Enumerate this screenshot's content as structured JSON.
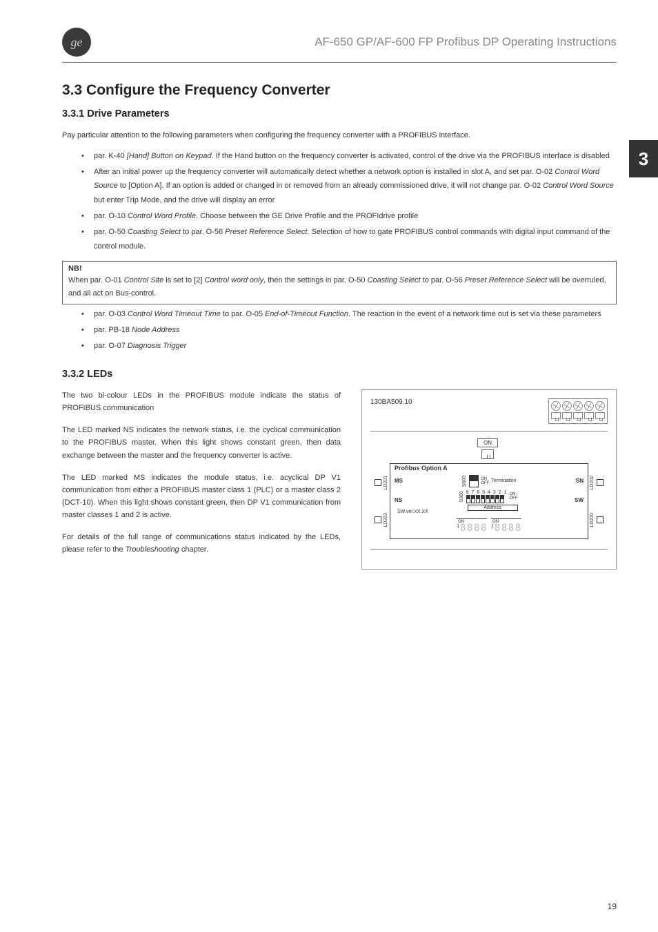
{
  "header": {
    "logo_text": "ge",
    "doc_title": "AF-650 GP/AF-600 FP Profibus DP Operating Instructions"
  },
  "side_tab": "3",
  "page_number": "19",
  "section": {
    "h2": "3.3  Configure the Frequency Converter",
    "s1": {
      "h3": "3.3.1  Drive Parameters",
      "intro": "Pay particular attention to the following parameters when configuring the frequency converter with a PROFIBUS interface.",
      "bullets1": [
        {
          "pre": "par. K-40 ",
          "em": "[Hand] Button on Keypad",
          "post": ". If the Hand button on the frequency converter is activated, control of the drive via the PROFIBUS interface is disabled"
        },
        {
          "pre": "After an initial power up the frequency converter will automatically detect whether a network option is installed in slot A, and set par. O-02 ",
          "em": "Control Word Source",
          "post": " to [Option A]. If an option is added or changed in or removed from an already commissioned drive, it will not change par. O-02 ",
          "em2": "Control Word Source",
          "post2": " but enter Trip Mode, and the drive will display an error"
        },
        {
          "pre": "par. O-10 ",
          "em": "Control Word Profile",
          "post": ". Choose between the GE Drive Profile and the PROFIdrive profile"
        },
        {
          "pre": "par. O-50 ",
          "em": "Coasting Select",
          "post": " to par. O-56 ",
          "em2": "Preset Reference Select",
          "post2": ". Selection of how to gate PROFIBUS control commands with digital input command of the control module."
        }
      ],
      "nb": {
        "title": "NB!",
        "body_pre": "When par. O-01 ",
        "body_em1": "Control Site",
        "body_mid1": " is set to [2] ",
        "body_em2": "Control word only",
        "body_mid2": ", then the settings in par. O-50 ",
        "body_em3": "Coasting Select",
        "body_mid3": " to par. O-56 ",
        "body_em4": "Preset Reference Select",
        "body_post": " will be overruled, and all act on Bus-control."
      },
      "bullets2": [
        {
          "pre": "par. O-03 ",
          "em": "Control Word Timeout Time",
          "post": " to par. O-05 ",
          "em2": "End-of-Timeout Function",
          "post2": ". The reaction in the event of a network time out is set via these parameters"
        },
        {
          "pre": "par. PB-18 ",
          "em": "Node Address",
          "post": ""
        },
        {
          "pre": "par. O-07 ",
          "em": "Diagnosis Trigger",
          "post": ""
        }
      ]
    },
    "s2": {
      "h3": "3.3.2  LEDs",
      "p1": "The two bi-colour LEDs in the PROFIBUS module indicate the status of PROFIBUS communication",
      "p2": "The LED marked NS indicates the network status, i.e. the cyclical communication to the PROFIBUS master. When this light shows constant green, then data exchange between the master and the frequency converter is active.",
      "p3": "The LED marked MS indicates the module status, i.e. acyclical DP V1 communication from either a PROFIBUS master class 1 (PLC) or a master class 2 (DCT-10). When this light shows constant green, then DP V1 communication from master classes 1 and 2 is active.",
      "p4_pre": "For details of the full range of communications status indicated by the LEDs, please refer to the ",
      "p4_em": "Troubleshooting",
      "p4_post": " chapter."
    }
  },
  "diagram": {
    "id": "130BA509.10",
    "on_label": "ON",
    "option_title": "Profibus Option A",
    "ms": "MS",
    "ns": "NS",
    "ld201": "LD201",
    "ld203": "LD203",
    "ld202": "LD202",
    "ld200": "LD200",
    "s600": "S600",
    "s300": "S300",
    "term_on": "ON",
    "term_off": "OFF",
    "termination": "Termination",
    "sn": "SN",
    "sw": "SW",
    "dip_nums": "8 7 6 5 4 3 2 1",
    "dip_on": "ON",
    "dip_off": "OFF",
    "swver": "SW.ver.XX.XX",
    "address": "Address",
    "disp_on": "ON",
    "disp_1": "1"
  }
}
